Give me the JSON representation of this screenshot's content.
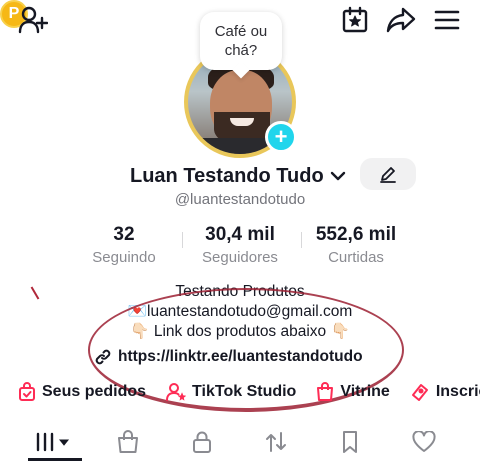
{
  "header": {
    "coin_label": "P",
    "icons": [
      "add-user-icon",
      "coin-icon",
      "calendar-star-icon",
      "share-icon",
      "menu-icon"
    ]
  },
  "profile": {
    "bubble_line1": "Café ou",
    "bubble_line2": "chá?",
    "name": "Luan Testando Tudo",
    "handle": "@luantestandotudo"
  },
  "stats": [
    {
      "value": "32",
      "label": "Seguindo"
    },
    {
      "value": "30,4 mil",
      "label": "Seguidores"
    },
    {
      "value": "552,6 mil",
      "label": "Curtidas"
    }
  ],
  "bio": {
    "line1": "Testando Produtos",
    "line2_emoji": "💌",
    "line2": "luantestandotudo@gmail.com",
    "line3_prefix": "👇🏻",
    "line3": "Link dos produtos abaixo",
    "line3_suffix": "👇🏻",
    "link": "https://linktr.ee/luantestandotudo"
  },
  "shortcuts": [
    {
      "label": "Seus pedidos",
      "icon": "bag-check-icon"
    },
    {
      "label": "TikTok Studio",
      "icon": "studio-person-icon"
    },
    {
      "label": "Vitrine",
      "icon": "shop-bag-icon"
    },
    {
      "label": "Inscriç",
      "icon": "ticket-icon"
    }
  ],
  "tabs": [
    "videos-grid-icon",
    "shop-icon",
    "lock-icon",
    "repost-icon",
    "bookmark-icon",
    "heart-icon"
  ],
  "colors": {
    "accent": "#fe2c55",
    "plus": "#20d5ec",
    "coin": "#f6b816",
    "text": "#161823",
    "muted": "#8a8b91"
  }
}
